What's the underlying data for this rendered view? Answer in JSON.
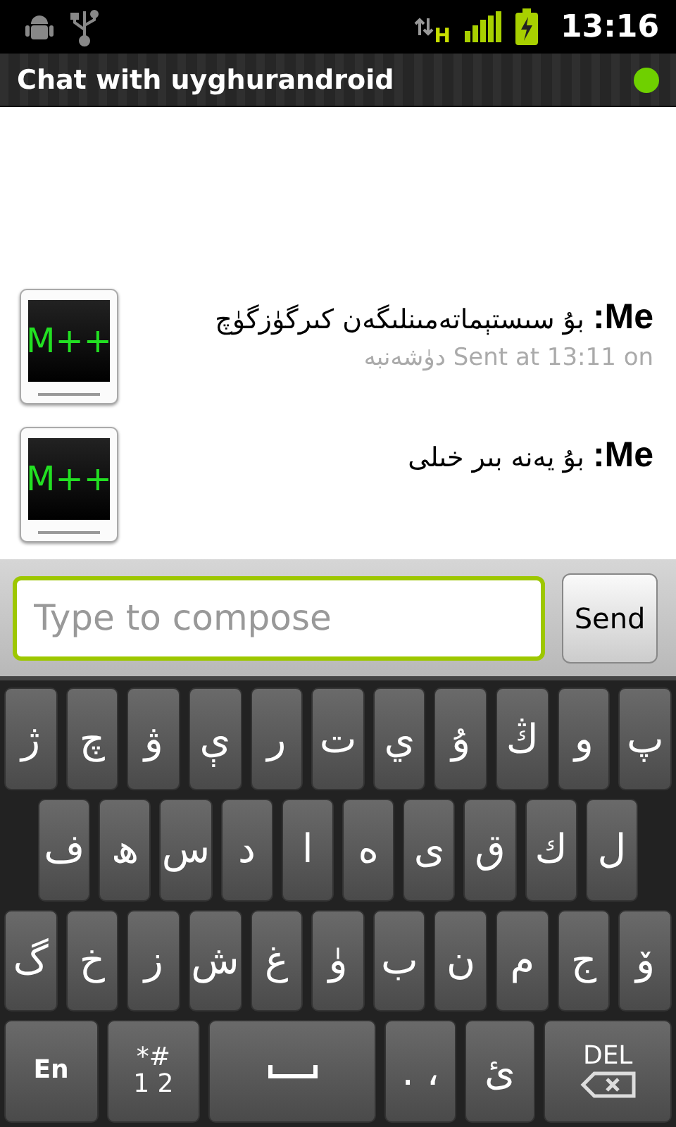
{
  "status_bar": {
    "network_type": "H",
    "time": "13:16"
  },
  "title_bar": {
    "title": "Chat with uyghurandroid",
    "online": true
  },
  "messages": [
    {
      "avatar": "M++",
      "text": "**Me:** بۇ سىستېماتەمىنلىگەن كىرگۈزگۈچ",
      "timestamp": "Sent at 13:11 on دۈشەنبە"
    },
    {
      "avatar": "M++",
      "text": "**Me:** بۇ يەنە بىر خىلى"
    }
  ],
  "compose": {
    "placeholder": "Type to compose",
    "send": "Send"
  },
  "keyboard": {
    "rows": [
      [
        "ژ",
        "چ",
        "ۋ",
        "ې",
        "ر",
        "ت",
        "ي",
        "ۇ",
        "ڭ",
        "و",
        "پ"
      ],
      [
        "ف",
        "ھ",
        "س",
        "د",
        "ا",
        "ە",
        "ى",
        "ق",
        "ك",
        "ل"
      ],
      [
        "گ",
        "خ",
        "ز",
        "ش",
        "غ",
        "ۈ",
        "ب",
        "ن",
        "م",
        "ج",
        "ۆ"
      ]
    ],
    "bottom": [
      {
        "kind": "lang",
        "label": "En"
      },
      {
        "kind": "symbols",
        "top": "*#",
        "bottom": "1 2"
      },
      {
        "kind": "space"
      },
      {
        "kind": "char",
        "label": ". ،"
      },
      {
        "kind": "char",
        "label": "ئ"
      },
      {
        "kind": "delete",
        "label": "DEL"
      }
    ]
  }
}
